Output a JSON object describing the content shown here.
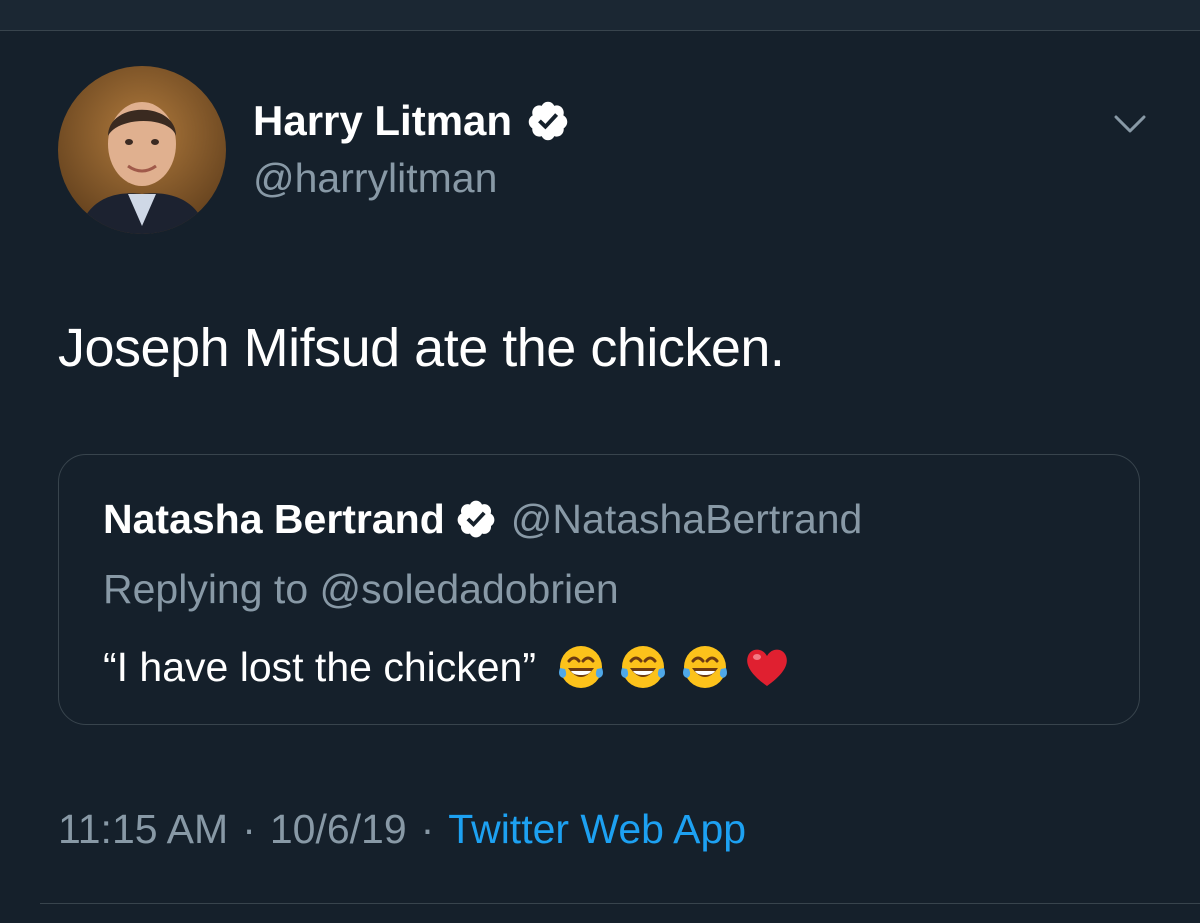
{
  "tweet": {
    "author": {
      "name": "Harry Litman",
      "handle": "@harrylitman",
      "verified": true
    },
    "text": "Joseph Mifsud ate the chicken.",
    "quoted": {
      "author_name": "Natasha Bertrand",
      "author_handle": "@NatashaBertrand",
      "verified": true,
      "replying_prefix": "Replying to ",
      "replying_to": "@soledadobrien",
      "text": "“I have lost the chicken”",
      "emojis": [
        "tears-of-joy",
        "tears-of-joy",
        "tears-of-joy",
        "red-heart"
      ]
    },
    "meta": {
      "time": "11:15 AM",
      "separator": "·",
      "date": "10/6/19",
      "source": "Twitter Web App"
    }
  },
  "colors": {
    "background": "#15202b",
    "text_primary": "#ffffff",
    "text_secondary": "#8899a6",
    "link": "#1da1f2",
    "border": "#38444d"
  }
}
